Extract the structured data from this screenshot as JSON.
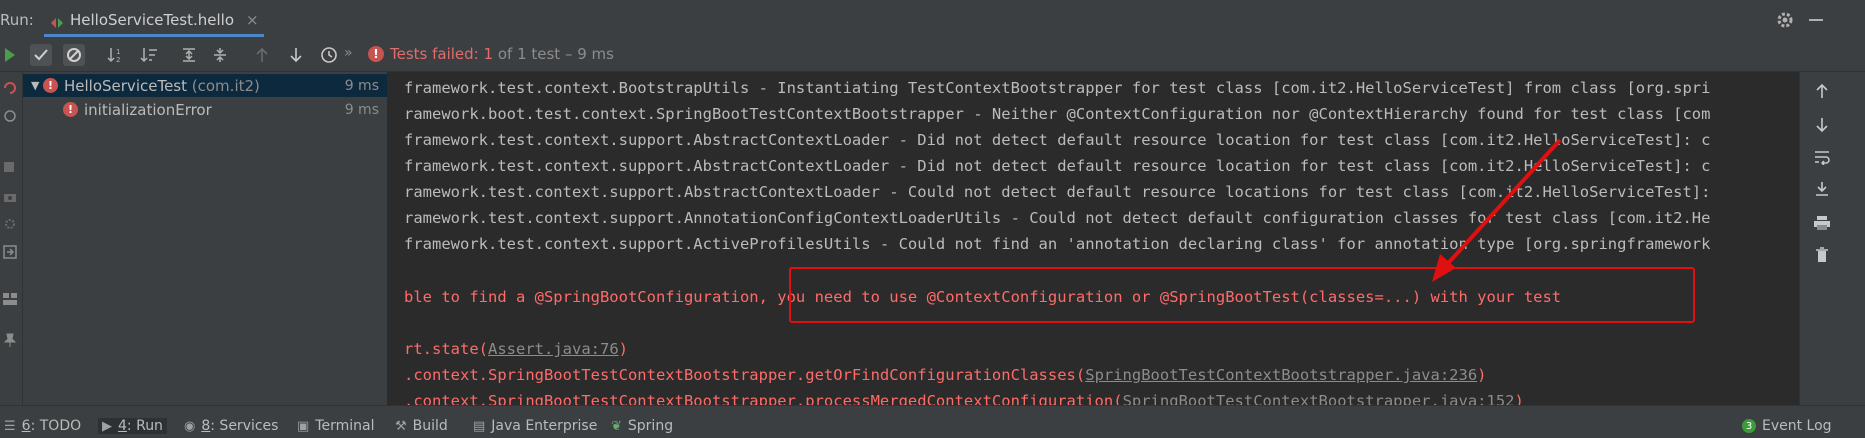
{
  "tabbar": {
    "run_label": "Run:",
    "tab_label": "HelloServiceTest.hello",
    "tab_close": "×"
  },
  "toolbar": {
    "chevron": "»",
    "status_failed": "Tests failed:",
    "status_count": "1",
    "status_of": "of 1 test",
    "status_sep": "–",
    "status_time": "9 ms"
  },
  "tree": {
    "rows": [
      {
        "name": "HelloServiceTest",
        "pkg": "(com.it2)",
        "time": "9 ms"
      },
      {
        "name": "initializationError",
        "time": "9 ms"
      }
    ]
  },
  "console": {
    "lines": [
      "framework.test.context.BootstrapUtils - Instantiating TestContextBootstrapper for test class [com.it2.HelloServiceTest] from class [org.spri",
      "ramework.boot.test.context.SpringBootTestContextBootstrapper - Neither @ContextConfiguration nor @ContextHierarchy found for test class [com",
      "framework.test.context.support.AbstractContextLoader - Did not detect default resource location for test class [com.it2.HelloServiceTest]: c",
      "framework.test.context.support.AbstractContextLoader - Did not detect default resource location for test class [com.it2.HelloServiceTest]: c",
      "ramework.test.context.support.AbstractContextLoader - Could not detect default resource locations for test class [com.it2.HelloServiceTest]:",
      "ramework.test.context.support.AnnotationConfigContextLoaderUtils - Could not detect default configuration classes for test class [com.it2.He",
      "framework.test.context.support.ActiveProfilesUtils - Could not find an 'annotation declaring class' for annotation type [org.springframework"
    ],
    "error_line": "ble to find a @SpringBootConfiguration, you need to use @ContextConfiguration or @SpringBootTest(classes=...) with your test",
    "trace": [
      {
        "pre": "rt.state(",
        "link": "Assert.java:76",
        "post": ")"
      },
      {
        "pre": ".context.SpringBootTestContextBootstrapper.getOrFindConfigurationClasses(",
        "link": "SpringBootTestContextBootstrapper.java:236",
        "post": ")"
      },
      {
        "pre": ".context.SpringBootTestContextBootstrapper.processMergedContextConfiguration(",
        "link": "SpringBootTestContextBootstrapper.java:152",
        "post": ")"
      }
    ]
  },
  "bottombar": {
    "todo_num": "6",
    "todo_label": ": TODO",
    "run_num": "4",
    "run_label": ": Run",
    "services_num": "8",
    "services_label": ": Services",
    "terminal": "Terminal",
    "build": "Build",
    "java_enterprise": "Java Enterprise",
    "spring": "Spring",
    "event_badge": "3",
    "event_log": "Event Log"
  },
  "colors": {
    "error": "#c75450",
    "annotation": "#e01010",
    "selection": "#0d293e",
    "accent_tab": "#4a88c7"
  }
}
